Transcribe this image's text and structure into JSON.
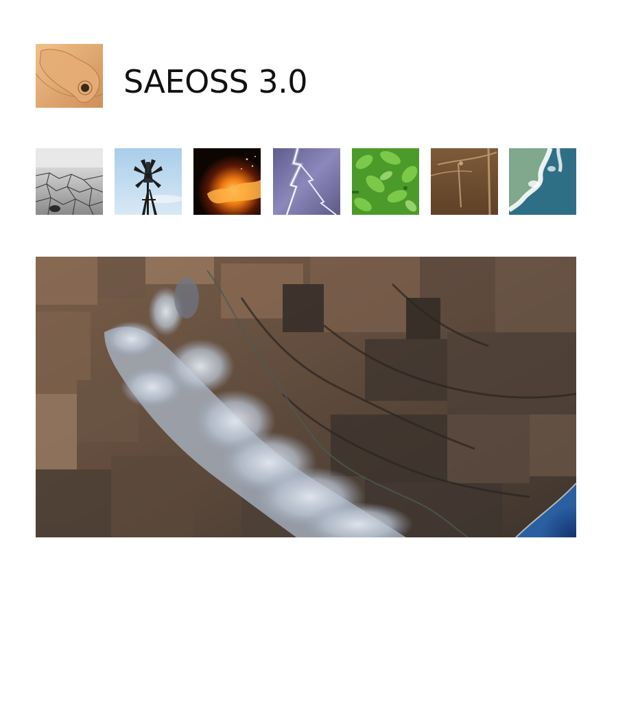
{
  "header": {
    "title": "SAEOSS 3.0",
    "logo_icon": "africa-globe-logo-icon"
  },
  "theme_thumbnails": [
    {
      "icon": "drought-cracked-earth-icon"
    },
    {
      "icon": "windpump-icon"
    },
    {
      "icon": "wildfire-icon"
    },
    {
      "icon": "lightning-storm-icon"
    },
    {
      "icon": "vegetation-leaves-icon"
    },
    {
      "icon": "wind-turbine-icon"
    },
    {
      "icon": "coastline-satellite-icon"
    }
  ],
  "hero": {
    "icon": "satellite-wildfire-smoke-image"
  },
  "colors": {
    "logo": "#dca06a",
    "background": "#ffffff"
  }
}
